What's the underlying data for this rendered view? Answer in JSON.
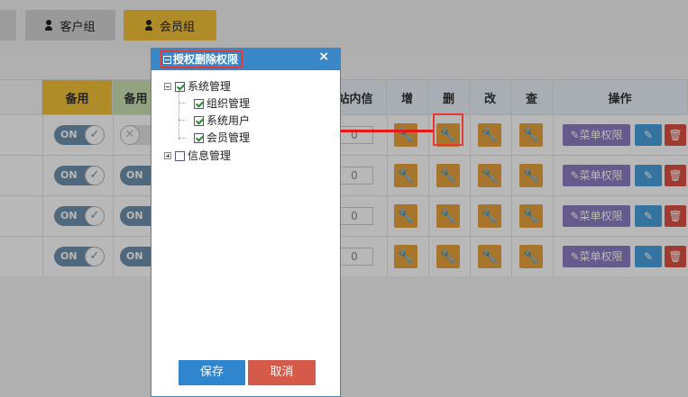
{
  "tabs": {
    "customer_group": "客户组",
    "member_group": "会员组"
  },
  "table": {
    "headers": {
      "backup1": "备用",
      "backup2": "备用",
      "site_msg": "站内信",
      "add": "增",
      "delete": "删",
      "modify": "改",
      "view": "查",
      "ops": "操作"
    },
    "toggle_on_label": "ON",
    "menu_perm_label": "菜单权限",
    "rows": [
      {
        "backup1": "ON",
        "backup2": "off",
        "site_msg": "0"
      },
      {
        "backup1": "ON",
        "backup2": "ON",
        "site_msg": "0"
      },
      {
        "backup1": "ON",
        "backup2": "ON",
        "site_msg": "0"
      },
      {
        "backup1": "ON",
        "backup2": "ON",
        "site_msg": "0"
      }
    ]
  },
  "dialog": {
    "title": "授权删除权限",
    "close": "×",
    "tree": {
      "system_mgmt": {
        "label": "系统管理",
        "checked": true,
        "expanded": true
      },
      "children": [
        {
          "label": "组织管理",
          "checked": true
        },
        {
          "label": "系统用户",
          "checked": true
        },
        {
          "label": "会员管理",
          "checked": true
        }
      ],
      "info_mgmt": {
        "label": "信息管理",
        "checked": false,
        "expanded": false
      }
    },
    "save": "保存",
    "cancel": "取消"
  },
  "colors": {
    "accent_blue": "#3a87c8",
    "annotation_red": "#e51919",
    "wrench_orange": "#e8a33e",
    "member_tab": "#f4c33a"
  }
}
